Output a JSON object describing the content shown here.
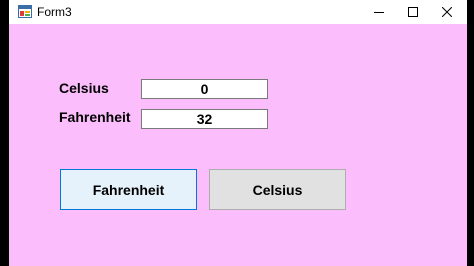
{
  "window": {
    "title": "Form3"
  },
  "labels": {
    "celsius": "Celsius",
    "fahrenheit": "Fahrenheit"
  },
  "fields": {
    "celsius_value": "0",
    "fahrenheit_value": "32"
  },
  "buttons": {
    "fahrenheit": "Fahrenheit",
    "celsius": "Celsius"
  },
  "icons": {
    "app": "form-app-icon",
    "minimize": "minimize-icon",
    "maximize": "maximize-icon",
    "close": "close-icon"
  },
  "colors": {
    "client_background": "#fbbdfb",
    "primary_button_border": "#0078d7",
    "primary_button_background": "#e5f1fb",
    "secondary_button_background": "#e1e1e1"
  }
}
